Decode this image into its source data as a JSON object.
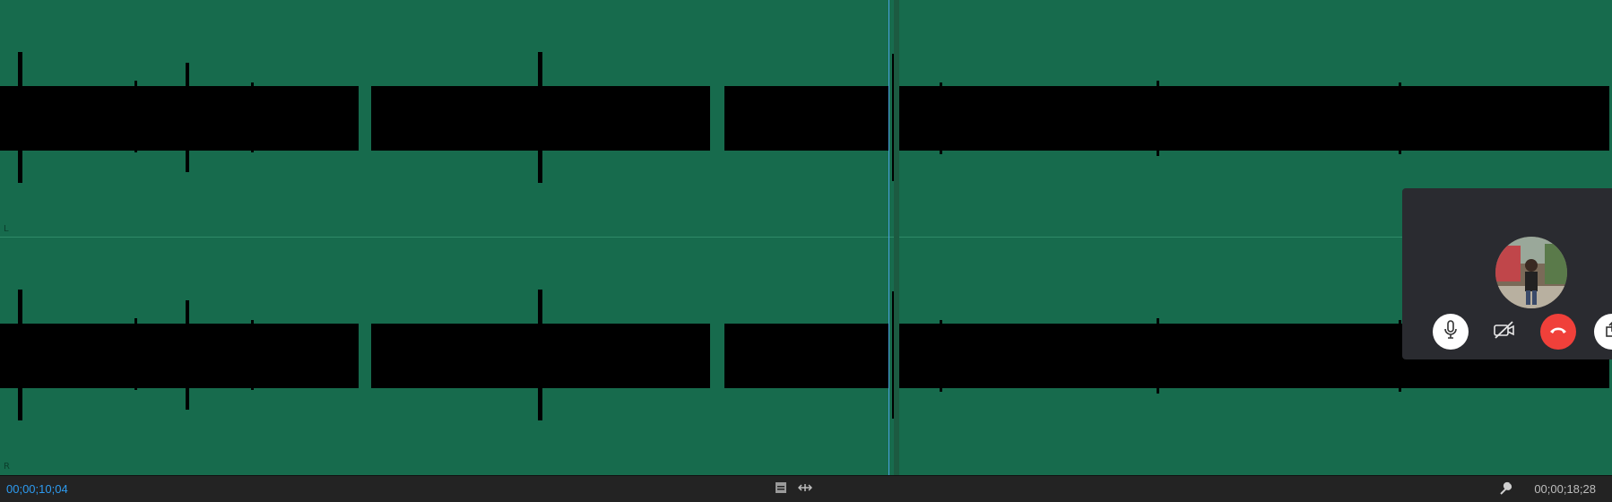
{
  "timeline": {
    "current_time": "00;00;10;04",
    "end_time": "00;00;18;28"
  },
  "channels": [
    {
      "label": "L"
    },
    {
      "label": "R"
    }
  ],
  "colors": {
    "waveform_bg": "#176b4d",
    "waveform": "#000000",
    "playhead": "#4aa3e0",
    "timecode": "#2d9bf0",
    "hangup": "#f0403a"
  },
  "call": {
    "mic_icon": "microphone-icon",
    "camera_icon": "camera-off-icon",
    "hangup_icon": "phone-hangup-icon",
    "share_icon": "share-screen-icon"
  }
}
